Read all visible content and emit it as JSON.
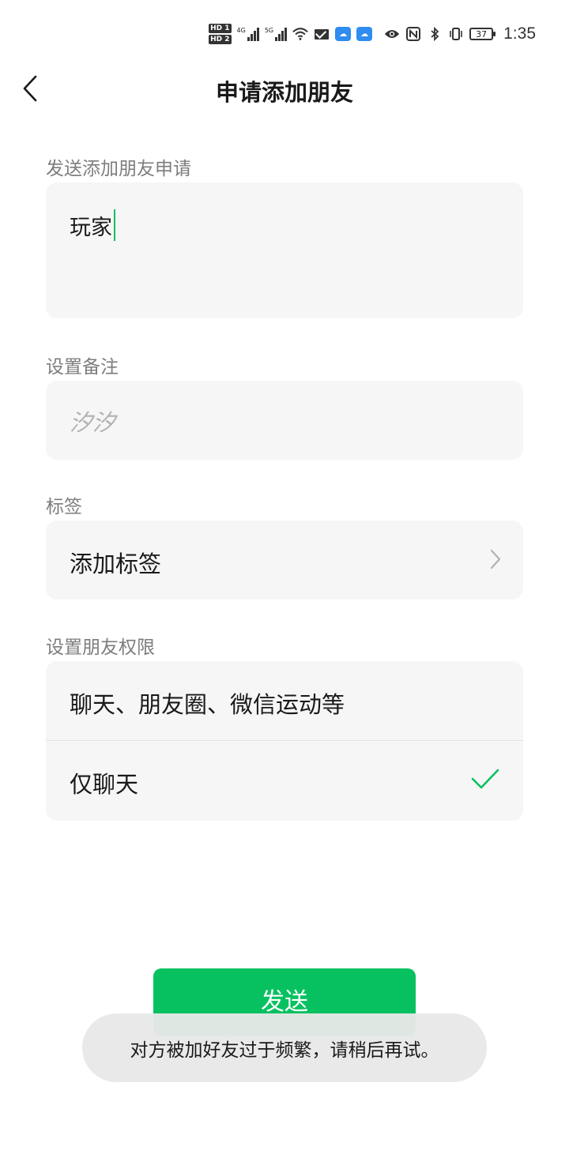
{
  "status_bar": {
    "hd1": "HD 1",
    "hd2": "HD 2",
    "net1": "4G",
    "net2": "5G",
    "battery": "37",
    "time": "1:35"
  },
  "header": {
    "title": "申请添加朋友",
    "back_icon": "chevron-left-icon"
  },
  "request": {
    "label": "发送添加朋友申请",
    "value": "玩家"
  },
  "remark": {
    "label": "设置备注",
    "placeholder": "汐汐"
  },
  "tags": {
    "label": "标签",
    "action": "添加标签"
  },
  "permissions": {
    "label": "设置朋友权限",
    "options": [
      {
        "label": "聊天、朋友圈、微信运动等",
        "selected": false
      },
      {
        "label": "仅聊天",
        "selected": true
      }
    ]
  },
  "send_button": "发送",
  "toast": "对方被加好友过于频繁，请稍后再试。",
  "colors": {
    "accent": "#07c160",
    "card_bg": "#f6f6f6"
  }
}
